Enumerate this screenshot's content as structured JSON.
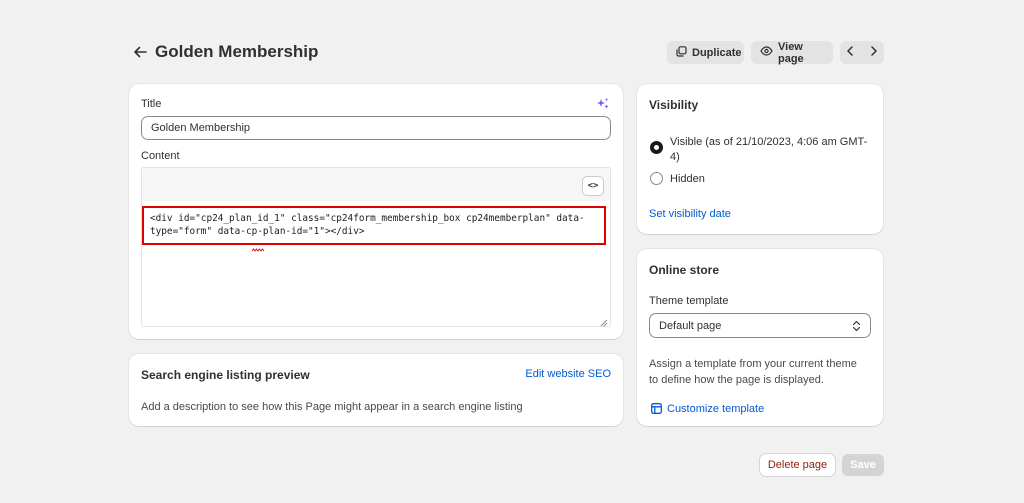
{
  "header": {
    "title": "Golden Membership",
    "duplicate_label": "Duplicate",
    "view_page_label": "View page"
  },
  "main": {
    "title_label": "Title",
    "title_value": "Golden Membership",
    "content_label": "Content",
    "code_button_label": "<>",
    "content_code_line1": "<div id=\"cp24_plan_id_1\" class=\"cp24form_membership_box cp24memberplan\" data-",
    "content_code_line2": "type=\"form\" data-cp-plan-id=\"1\"></div>"
  },
  "seo": {
    "heading": "Search engine listing preview",
    "edit_link": "Edit website SEO",
    "description": "Add a description to see how this Page might appear in a search engine listing"
  },
  "visibility": {
    "heading": "Visibility",
    "visible_label_line1": "Visible (as of 21/10/2023, 4:06 am GMT-",
    "visible_label_line2": "4)",
    "hidden_label": "Hidden",
    "set_date_link": "Set visibility date"
  },
  "online_store": {
    "heading": "Online store",
    "theme_template_label": "Theme template",
    "theme_template_value": "Default page",
    "help_line1": "Assign a template from your current theme",
    "help_line2": "to define how the page is displayed.",
    "customize_link": "Customize template"
  },
  "footer": {
    "delete_label": "Delete page",
    "save_label": "Save"
  },
  "colors": {
    "accent_link": "#005bd3",
    "highlight_border": "#e00000",
    "delete_text": "#8e1f0b",
    "magic_icon": "#8051ff"
  }
}
